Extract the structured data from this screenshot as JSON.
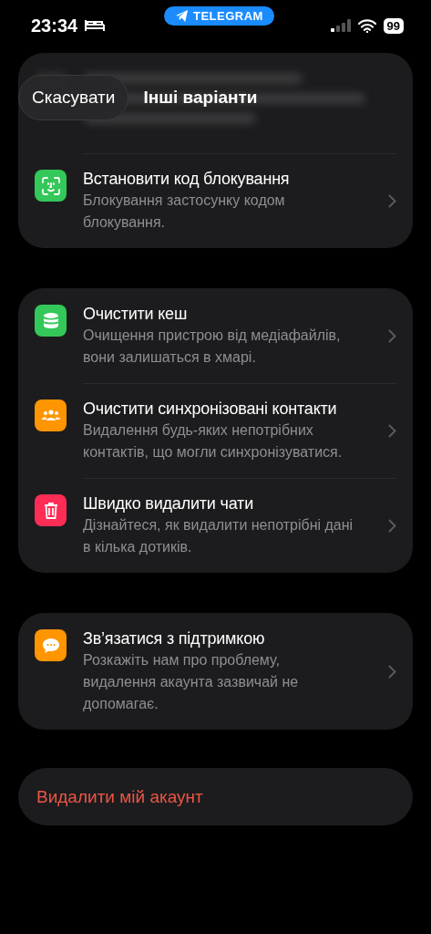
{
  "status_bar": {
    "time": "23:34",
    "app_pill": "TELEGRAM",
    "battery": "99"
  },
  "header": {
    "cancel": "Скасувати",
    "title": "Інші варіанти"
  },
  "groups": [
    {
      "blurred_top": true,
      "items": [
        {
          "kind": "face",
          "color": "#34c759",
          "title": "Встановити код блокування",
          "subtitle": "Блокування застосунку кодом блокування."
        }
      ]
    },
    {
      "blurred_top": false,
      "items": [
        {
          "kind": "database",
          "color": "#34c759",
          "title": "Очистити кеш",
          "subtitle": "Очищення пристрою від медіафайлів, вони залишаться в хмарі."
        },
        {
          "kind": "people",
          "color": "#ff9500",
          "title": "Очистити синхронізовані контакти",
          "subtitle": "Видалення будь-яких непотрібних контактів, що могли синхронізуватися."
        },
        {
          "kind": "trash",
          "color": "#ff2d55",
          "title": "Швидко видалити чати",
          "subtitle": "Дізнайтеся, як видалити непотрібні дані в кілька дотиків."
        }
      ]
    },
    {
      "blurred_top": false,
      "items": [
        {
          "kind": "chat",
          "color": "#ff9500",
          "title": "Зв’язатися з підтримкою",
          "subtitle": "Розкажіть нам про проблему, видалення акаунта зазвичай не допомагає."
        }
      ]
    }
  ],
  "delete_button": "Видалити мій акаунт"
}
